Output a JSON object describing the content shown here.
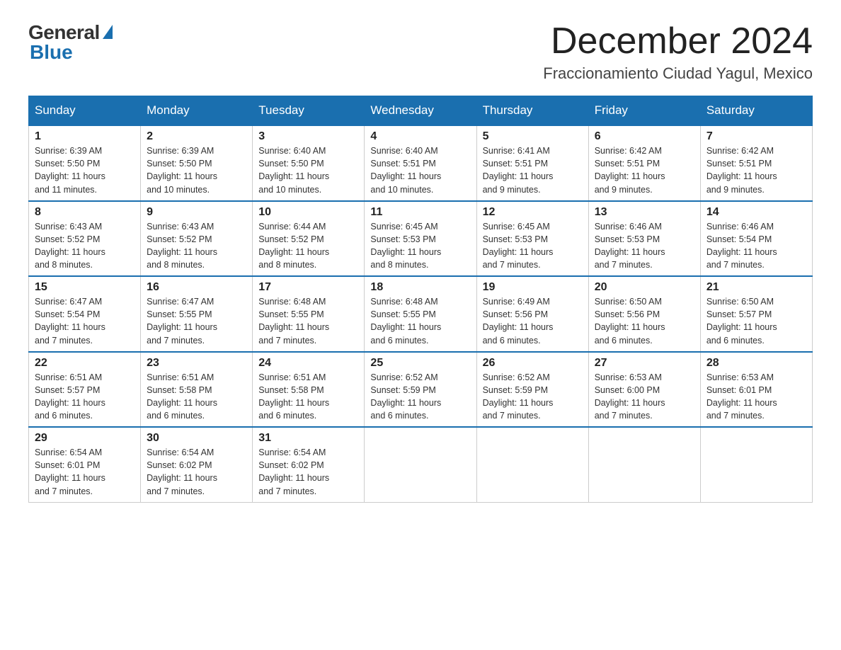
{
  "header": {
    "logo_general": "General",
    "logo_blue": "Blue",
    "month_title": "December 2024",
    "location": "Fraccionamiento Ciudad Yagul, Mexico"
  },
  "days_of_week": [
    "Sunday",
    "Monday",
    "Tuesday",
    "Wednesday",
    "Thursday",
    "Friday",
    "Saturday"
  ],
  "weeks": [
    [
      {
        "day": "1",
        "sunrise": "6:39 AM",
        "sunset": "5:50 PM",
        "daylight": "11 hours and 11 minutes."
      },
      {
        "day": "2",
        "sunrise": "6:39 AM",
        "sunset": "5:50 PM",
        "daylight": "11 hours and 10 minutes."
      },
      {
        "day": "3",
        "sunrise": "6:40 AM",
        "sunset": "5:50 PM",
        "daylight": "11 hours and 10 minutes."
      },
      {
        "day": "4",
        "sunrise": "6:40 AM",
        "sunset": "5:51 PM",
        "daylight": "11 hours and 10 minutes."
      },
      {
        "day": "5",
        "sunrise": "6:41 AM",
        "sunset": "5:51 PM",
        "daylight": "11 hours and 9 minutes."
      },
      {
        "day": "6",
        "sunrise": "6:42 AM",
        "sunset": "5:51 PM",
        "daylight": "11 hours and 9 minutes."
      },
      {
        "day": "7",
        "sunrise": "6:42 AM",
        "sunset": "5:51 PM",
        "daylight": "11 hours and 9 minutes."
      }
    ],
    [
      {
        "day": "8",
        "sunrise": "6:43 AM",
        "sunset": "5:52 PM",
        "daylight": "11 hours and 8 minutes."
      },
      {
        "day": "9",
        "sunrise": "6:43 AM",
        "sunset": "5:52 PM",
        "daylight": "11 hours and 8 minutes."
      },
      {
        "day": "10",
        "sunrise": "6:44 AM",
        "sunset": "5:52 PM",
        "daylight": "11 hours and 8 minutes."
      },
      {
        "day": "11",
        "sunrise": "6:45 AM",
        "sunset": "5:53 PM",
        "daylight": "11 hours and 8 minutes."
      },
      {
        "day": "12",
        "sunrise": "6:45 AM",
        "sunset": "5:53 PM",
        "daylight": "11 hours and 7 minutes."
      },
      {
        "day": "13",
        "sunrise": "6:46 AM",
        "sunset": "5:53 PM",
        "daylight": "11 hours and 7 minutes."
      },
      {
        "day": "14",
        "sunrise": "6:46 AM",
        "sunset": "5:54 PM",
        "daylight": "11 hours and 7 minutes."
      }
    ],
    [
      {
        "day": "15",
        "sunrise": "6:47 AM",
        "sunset": "5:54 PM",
        "daylight": "11 hours and 7 minutes."
      },
      {
        "day": "16",
        "sunrise": "6:47 AM",
        "sunset": "5:55 PM",
        "daylight": "11 hours and 7 minutes."
      },
      {
        "day": "17",
        "sunrise": "6:48 AM",
        "sunset": "5:55 PM",
        "daylight": "11 hours and 7 minutes."
      },
      {
        "day": "18",
        "sunrise": "6:48 AM",
        "sunset": "5:55 PM",
        "daylight": "11 hours and 6 minutes."
      },
      {
        "day": "19",
        "sunrise": "6:49 AM",
        "sunset": "5:56 PM",
        "daylight": "11 hours and 6 minutes."
      },
      {
        "day": "20",
        "sunrise": "6:50 AM",
        "sunset": "5:56 PM",
        "daylight": "11 hours and 6 minutes."
      },
      {
        "day": "21",
        "sunrise": "6:50 AM",
        "sunset": "5:57 PM",
        "daylight": "11 hours and 6 minutes."
      }
    ],
    [
      {
        "day": "22",
        "sunrise": "6:51 AM",
        "sunset": "5:57 PM",
        "daylight": "11 hours and 6 minutes."
      },
      {
        "day": "23",
        "sunrise": "6:51 AM",
        "sunset": "5:58 PM",
        "daylight": "11 hours and 6 minutes."
      },
      {
        "day": "24",
        "sunrise": "6:51 AM",
        "sunset": "5:58 PM",
        "daylight": "11 hours and 6 minutes."
      },
      {
        "day": "25",
        "sunrise": "6:52 AM",
        "sunset": "5:59 PM",
        "daylight": "11 hours and 6 minutes."
      },
      {
        "day": "26",
        "sunrise": "6:52 AM",
        "sunset": "5:59 PM",
        "daylight": "11 hours and 7 minutes."
      },
      {
        "day": "27",
        "sunrise": "6:53 AM",
        "sunset": "6:00 PM",
        "daylight": "11 hours and 7 minutes."
      },
      {
        "day": "28",
        "sunrise": "6:53 AM",
        "sunset": "6:01 PM",
        "daylight": "11 hours and 7 minutes."
      }
    ],
    [
      {
        "day": "29",
        "sunrise": "6:54 AM",
        "sunset": "6:01 PM",
        "daylight": "11 hours and 7 minutes."
      },
      {
        "day": "30",
        "sunrise": "6:54 AM",
        "sunset": "6:02 PM",
        "daylight": "11 hours and 7 minutes."
      },
      {
        "day": "31",
        "sunrise": "6:54 AM",
        "sunset": "6:02 PM",
        "daylight": "11 hours and 7 minutes."
      },
      null,
      null,
      null,
      null
    ]
  ],
  "labels": {
    "sunrise": "Sunrise:",
    "sunset": "Sunset:",
    "daylight": "Daylight:"
  }
}
